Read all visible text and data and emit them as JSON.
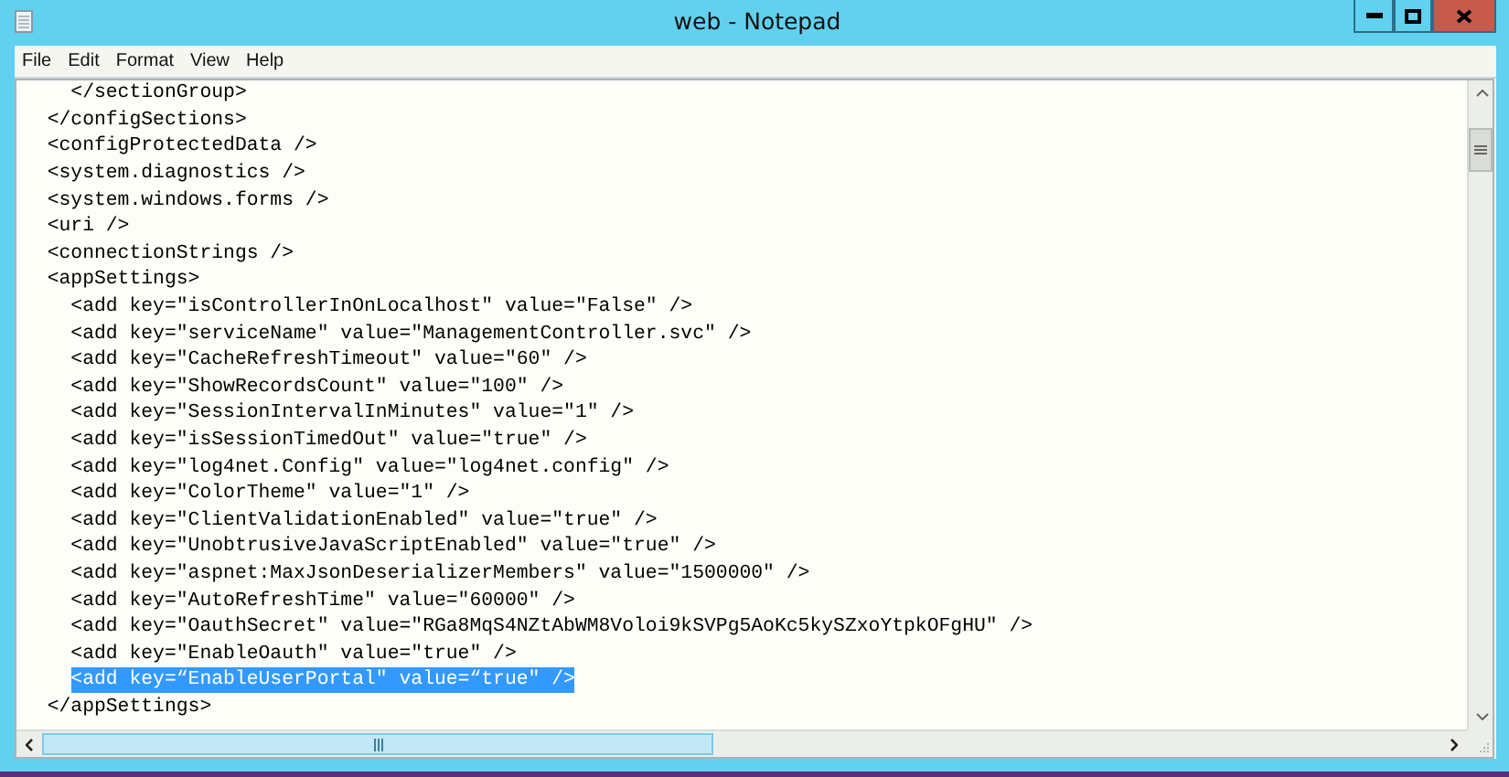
{
  "window": {
    "title": "web - Notepad"
  },
  "menu": [
    {
      "label": "File"
    },
    {
      "label": "Edit"
    },
    {
      "label": "Format"
    },
    {
      "label": "View"
    },
    {
      "label": "Help"
    }
  ],
  "lines": [
    {
      "text": "    </sectionGroup>",
      "selected": false
    },
    {
      "text": "  </configSections>",
      "selected": false
    },
    {
      "text": "  <configProtectedData />",
      "selected": false
    },
    {
      "text": "  <system.diagnostics />",
      "selected": false
    },
    {
      "text": "  <system.windows.forms />",
      "selected": false
    },
    {
      "text": "  <uri />",
      "selected": false
    },
    {
      "text": "  <connectionStrings />",
      "selected": false
    },
    {
      "text": "  <appSettings>",
      "selected": false
    },
    {
      "text": "    <add key=\"isControllerInOnLocalhost\" value=\"False\" />",
      "selected": false
    },
    {
      "text": "    <add key=\"serviceName\" value=\"ManagementController.svc\" />",
      "selected": false
    },
    {
      "text": "    <add key=\"CacheRefreshTimeout\" value=\"60\" />",
      "selected": false
    },
    {
      "text": "    <add key=\"ShowRecordsCount\" value=\"100\" />",
      "selected": false
    },
    {
      "text": "    <add key=\"SessionIntervalInMinutes\" value=\"1\" />",
      "selected": false
    },
    {
      "text": "    <add key=\"isSessionTimedOut\" value=\"true\" />",
      "selected": false
    },
    {
      "text": "    <add key=\"log4net.Config\" value=\"log4net.config\" />",
      "selected": false
    },
    {
      "text": "    <add key=\"ColorTheme\" value=\"1\" />",
      "selected": false
    },
    {
      "text": "    <add key=\"ClientValidationEnabled\" value=\"true\" />",
      "selected": false
    },
    {
      "text": "    <add key=\"UnobtrusiveJavaScriptEnabled\" value=\"true\" />",
      "selected": false
    },
    {
      "text": "    <add key=\"aspnet:MaxJsonDeserializerMembers\" value=\"1500000\" />",
      "selected": false
    },
    {
      "text": "    <add key=\"AutoRefreshTime\" value=\"60000\" />",
      "selected": false
    },
    {
      "text": "    <add key=\"OauthSecret\" value=\"RGa8MqS4NZtAbWM8Voloi9kSVPg5AoKc5kySZxoYtpkOFgHU\" />",
      "selected": false
    },
    {
      "text": "    <add key=\"EnableOauth\" value=\"true\" />",
      "selected": false
    },
    {
      "text": "    <add key=“EnableUserPortal\" value=“true\" />",
      "selected": true
    },
    {
      "text": "  </appSettings>",
      "selected": false
    }
  ]
}
